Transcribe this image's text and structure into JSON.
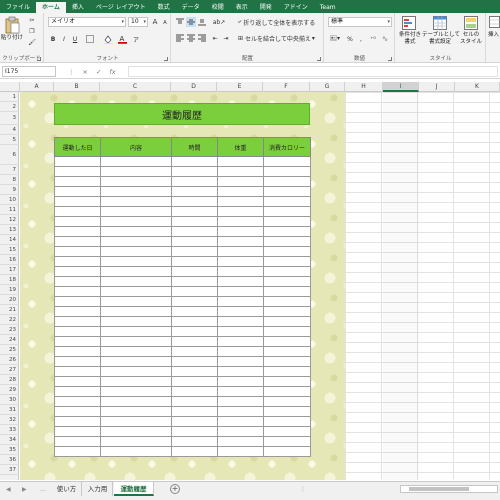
{
  "ribbon_tabs": [
    "ファイル",
    "ホーム",
    "挿入",
    "ページ レイアウト",
    "数式",
    "データ",
    "校閲",
    "表示",
    "開発",
    "アドイン",
    "Team"
  ],
  "clipboard": {
    "paste_label": "貼り付け",
    "group_label": "クリップボード"
  },
  "font": {
    "font_name": "メイリオ",
    "font_size": "10",
    "grow": "A",
    "shrink": "A",
    "bold": "B",
    "italic": "I",
    "underline": "U",
    "group_label": "フォント"
  },
  "alignment": {
    "wrap_label": "折り返して全体を表示する",
    "merge_label": "セルを結合して中央揃え",
    "group_label": "配置"
  },
  "number": {
    "format": "標準",
    "percent": "%",
    "comma": ",",
    "group_label": "数値"
  },
  "styles": {
    "conditional": "条件付き\n書式",
    "table": "テーブルとして\n書式設定",
    "cell": "セルの\nスタイル",
    "group_label": "スタイル"
  },
  "insert_label": "挿入",
  "formula_bar": {
    "name_box": "I175",
    "fx": "fx",
    "cancel": "×",
    "enter": "✓",
    "value": ""
  },
  "columns": [
    "A",
    "B",
    "C",
    "D",
    "E",
    "F",
    "G",
    "H",
    "I",
    "J",
    "K"
  ],
  "selected_column": "I",
  "rows": [
    "1",
    "2",
    "3",
    "4",
    "5",
    "6",
    "7",
    "8",
    "9",
    "10",
    "11",
    "12",
    "13",
    "14",
    "15",
    "16",
    "17",
    "18",
    "19",
    "20",
    "21",
    "22",
    "23",
    "24",
    "25",
    "26",
    "27",
    "28",
    "29",
    "30",
    "31",
    "32",
    "33",
    "34",
    "35",
    "36",
    "37"
  ],
  "sheet": {
    "title": "運動履歴",
    "headers": [
      "運動した日",
      "内容",
      "時間",
      "体重",
      "消費カロリー"
    ],
    "empty_rows": 30
  },
  "sheet_tabs": [
    "使い方",
    "入力用",
    "運動履歴"
  ],
  "active_sheet": "運動履歴",
  "colors": {
    "excel_green": "#217346",
    "header_green": "#7ccf3c",
    "pattern_bg": "#e6e7b6"
  }
}
